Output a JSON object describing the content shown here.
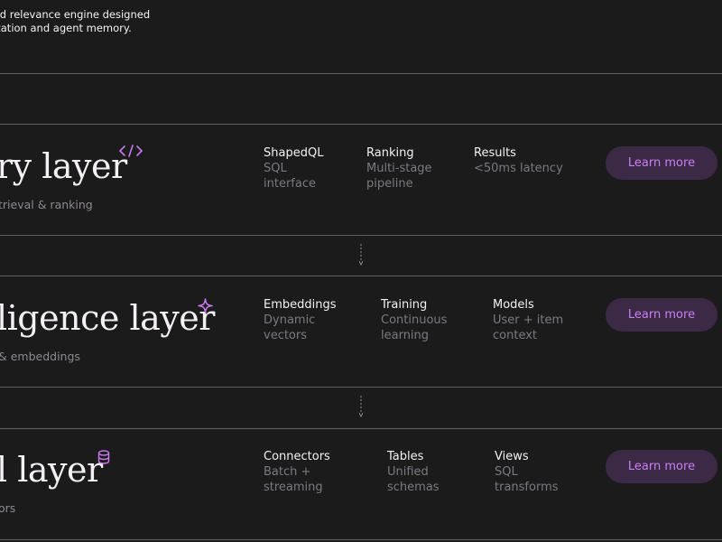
{
  "intro": {
    "line1": "o-end relevance engine designed",
    "line2": "nalization and agent memory."
  },
  "layers": [
    {
      "title": "ry layer",
      "subtitle": "trieval & ranking",
      "icon": "code-icon",
      "stats": [
        {
          "label": "ShapedQL",
          "desc": "SQL\ninterface"
        },
        {
          "label": "Ranking",
          "desc": "Multi-stage\npipeline"
        },
        {
          "label": "Results",
          "desc": "<50ms latency"
        }
      ],
      "button": "Learn more"
    },
    {
      "title": "ligence layer",
      "subtitle": "& embeddings",
      "icon": "sparkle-icon",
      "stats": [
        {
          "label": "Embeddings",
          "desc": "Dynamic\nvectors"
        },
        {
          "label": "Training",
          "desc": "Continuous\nlearning"
        },
        {
          "label": "Models",
          "desc": "User + item\ncontext"
        }
      ],
      "button": "Learn more"
    },
    {
      "title": "l layer",
      "subtitle": "ors",
      "icon": "database-icon",
      "stats": [
        {
          "label": "Connectors",
          "desc": "Batch +\nstreaming"
        },
        {
          "label": "Tables",
          "desc": "Unified\nschemas"
        },
        {
          "label": "Views",
          "desc": "SQL\ntransforms"
        }
      ],
      "button": "Learn more"
    }
  ],
  "colors": {
    "background": "#1c1b1c",
    "accent": "#c978f2",
    "button_bg": "#3b2946",
    "divider": "#626064"
  }
}
